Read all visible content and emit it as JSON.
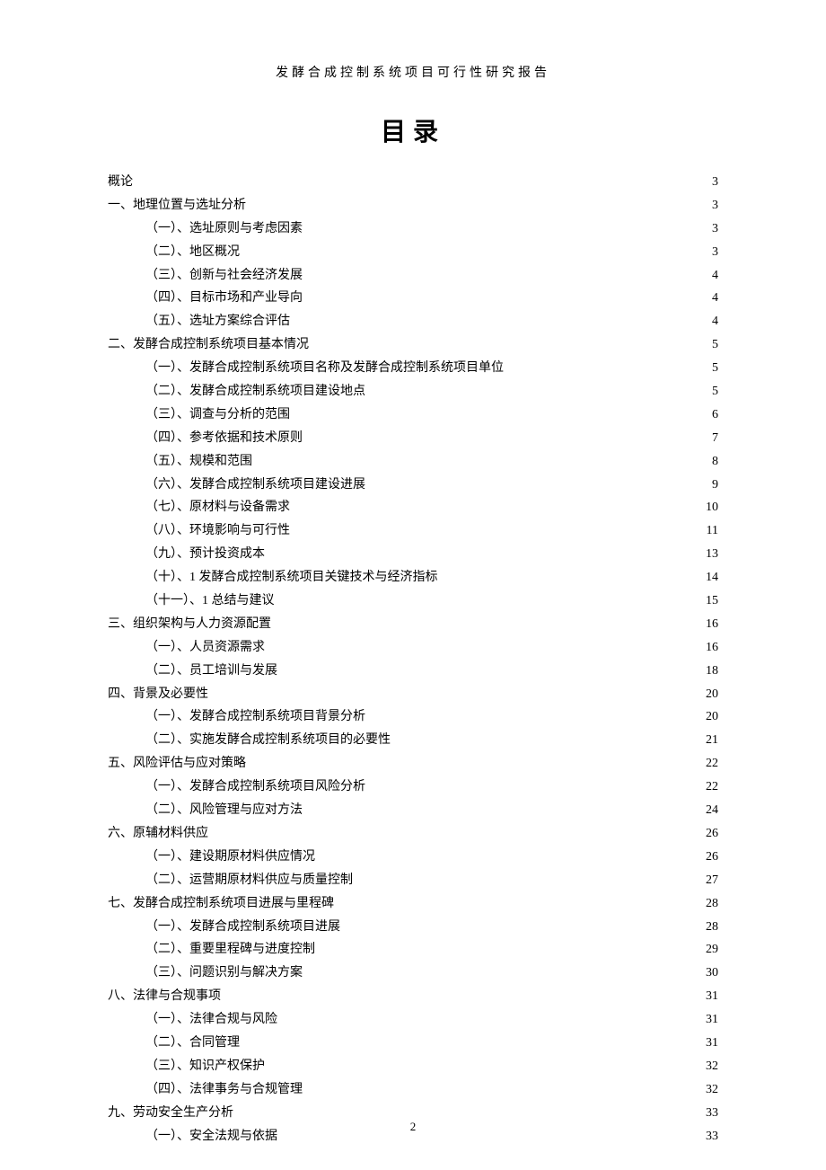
{
  "header": "发酵合成控制系统项目可行性研究报告",
  "title": "目录",
  "page_number": "2",
  "toc": [
    {
      "label": "概论",
      "page": "3",
      "indent": 0
    },
    {
      "label": "一、地理位置与选址分析",
      "page": "3",
      "indent": 0
    },
    {
      "label": "（一）、选址原则与考虑因素",
      "page": "3",
      "indent": 1
    },
    {
      "label": "（二）、地区概况",
      "page": "3",
      "indent": 1
    },
    {
      "label": "（三）、创新与社会经济发展",
      "page": "4",
      "indent": 1
    },
    {
      "label": "（四）、目标市场和产业导向",
      "page": "4",
      "indent": 1
    },
    {
      "label": "（五）、选址方案综合评估",
      "page": "4",
      "indent": 1
    },
    {
      "label": "二、发酵合成控制系统项目基本情况",
      "page": "5",
      "indent": 0
    },
    {
      "label": "（一）、发酵合成控制系统项目名称及发酵合成控制系统项目单位",
      "page": "5",
      "indent": 1
    },
    {
      "label": "（二）、发酵合成控制系统项目建设地点",
      "page": "5",
      "indent": 1
    },
    {
      "label": "（三）、调查与分析的范围",
      "page": "6",
      "indent": 1
    },
    {
      "label": "（四）、参考依据和技术原则",
      "page": "7",
      "indent": 1
    },
    {
      "label": "（五）、规模和范围",
      "page": "8",
      "indent": 1
    },
    {
      "label": "（六）、发酵合成控制系统项目建设进展",
      "page": "9",
      "indent": 1
    },
    {
      "label": "（七）、原材料与设备需求",
      "page": "10",
      "indent": 1
    },
    {
      "label": "（八）、环境影响与可行性",
      "page": "11",
      "indent": 1
    },
    {
      "label": "（九）、预计投资成本",
      "page": "13",
      "indent": 1
    },
    {
      "label": "（十）、1 发酵合成控制系统项目关键技术与经济指标",
      "page": "14",
      "indent": 1
    },
    {
      "label": "（十一）、1 总结与建议",
      "page": "15",
      "indent": 1
    },
    {
      "label": "三、组织架构与人力资源配置",
      "page": "16",
      "indent": 0
    },
    {
      "label": "（一）、人员资源需求",
      "page": "16",
      "indent": 1
    },
    {
      "label": "（二）、员工培训与发展",
      "page": "18",
      "indent": 1
    },
    {
      "label": "四、背景及必要性",
      "page": "20",
      "indent": 0
    },
    {
      "label": "（一）、发酵合成控制系统项目背景分析",
      "page": "20",
      "indent": 1
    },
    {
      "label": "（二）、实施发酵合成控制系统项目的必要性",
      "page": "21",
      "indent": 1
    },
    {
      "label": "五、风险评估与应对策略",
      "page": "22",
      "indent": 0
    },
    {
      "label": "（一）、发酵合成控制系统项目风险分析",
      "page": "22",
      "indent": 1
    },
    {
      "label": "（二）、风险管理与应对方法",
      "page": "24",
      "indent": 1
    },
    {
      "label": "六、原辅材料供应",
      "page": "26",
      "indent": 0
    },
    {
      "label": "（一）、建设期原材料供应情况",
      "page": "26",
      "indent": 1
    },
    {
      "label": "（二）、运营期原材料供应与质量控制",
      "page": "27",
      "indent": 1
    },
    {
      "label": "七、发酵合成控制系统项目进展与里程碑",
      "page": "28",
      "indent": 0
    },
    {
      "label": "（一）、发酵合成控制系统项目进展",
      "page": "28",
      "indent": 1
    },
    {
      "label": "（二）、重要里程碑与进度控制",
      "page": "29",
      "indent": 1
    },
    {
      "label": "（三）、问题识别与解决方案",
      "page": "30",
      "indent": 1
    },
    {
      "label": "八、法律与合规事项",
      "page": "31",
      "indent": 0
    },
    {
      "label": "（一）、法律合规与风险",
      "page": "31",
      "indent": 1
    },
    {
      "label": "（二）、合同管理",
      "page": "31",
      "indent": 1
    },
    {
      "label": "（三）、知识产权保护",
      "page": "32",
      "indent": 1
    },
    {
      "label": "（四）、法律事务与合规管理",
      "page": "32",
      "indent": 1
    },
    {
      "label": "九、劳动安全生产分析",
      "page": "33",
      "indent": 0
    },
    {
      "label": "（一）、安全法规与依据",
      "page": "33",
      "indent": 1
    }
  ]
}
